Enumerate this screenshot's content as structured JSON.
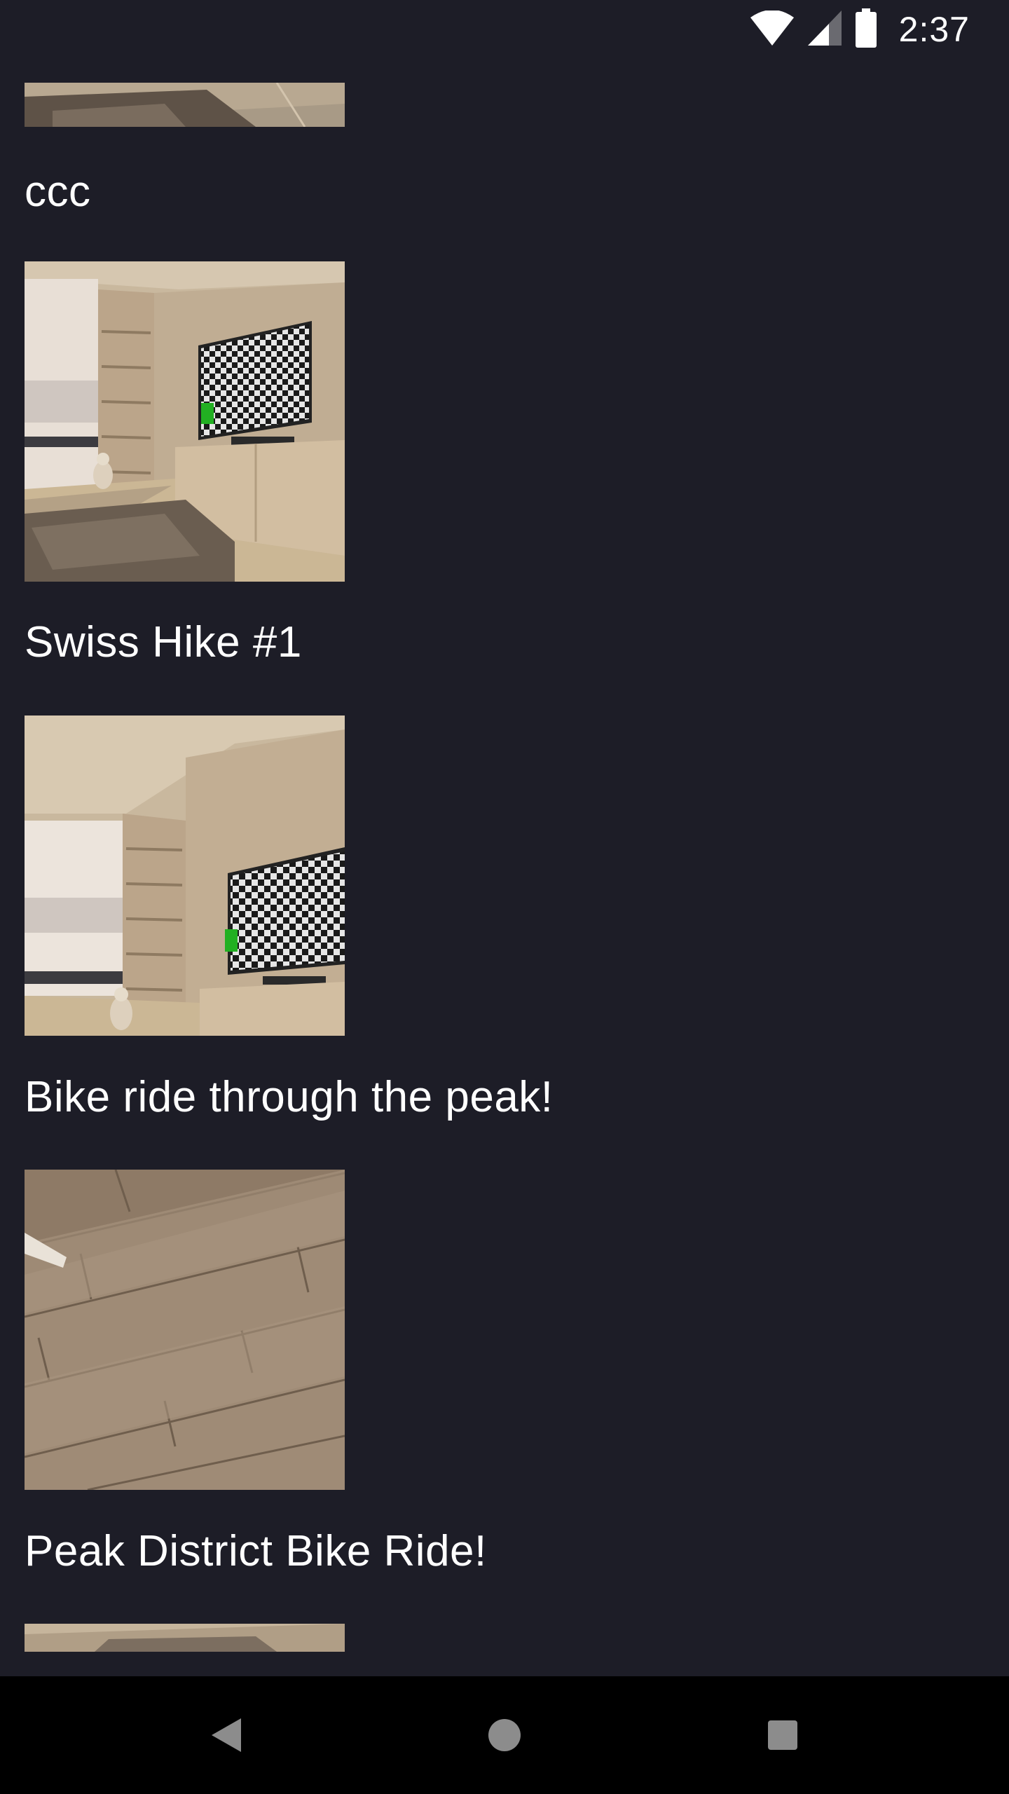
{
  "status_bar": {
    "time": "2:37",
    "icons": [
      "wifi-icon",
      "cell-signal-icon",
      "battery-icon"
    ]
  },
  "feed": {
    "items": [
      {
        "caption": "ccc"
      },
      {
        "caption": "Swiss Hike #1"
      },
      {
        "caption": "Bike ride through the peak!"
      },
      {
        "caption": "Peak District Bike Ride!"
      }
    ]
  },
  "nav_bar": {
    "buttons": [
      "back-icon",
      "home-icon",
      "recents-icon"
    ]
  },
  "colors": {
    "background": "#1d1d27",
    "text": "#ffffff",
    "nav_background": "#000000"
  }
}
